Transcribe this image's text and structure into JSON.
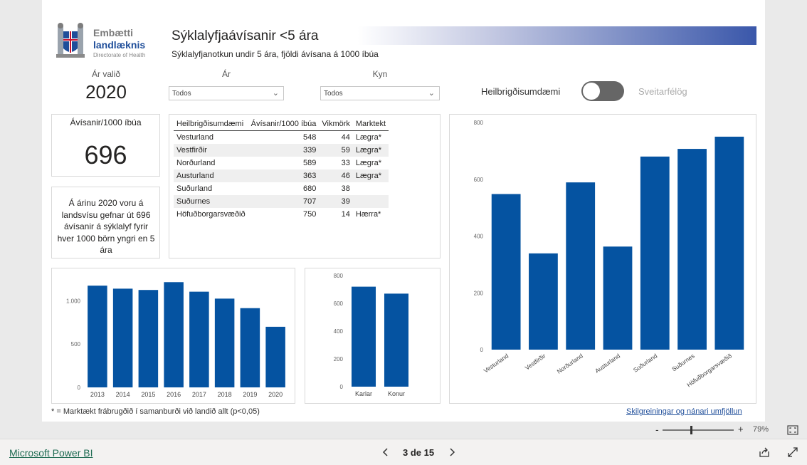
{
  "header": {
    "logo": {
      "line1": "Embætti",
      "line2": "landlæknis",
      "line3": "Directorate of Health"
    },
    "title": "Sýklalyfjaávísanir <5 ára",
    "subtitle": "Sýklalyfjanotkun undir 5 ára, fjöldi ávísana á 1000 íbúa"
  },
  "filters": {
    "year_selected_label": "Ár valið",
    "year_selected": "2020",
    "year_label": "Ár",
    "year_value": "Todos",
    "sex_label": "Kyn",
    "sex_value": "Todos",
    "toggle_left": "Heilbrigðisumdæmi",
    "toggle_right": "Sveitarfélög"
  },
  "kpi": {
    "label": "Ávísanir/1000 íbúa",
    "value": "696"
  },
  "note_text": "Á árinu 2020 voru á landsvísu gefnar út 696 ávísanir á sýklalyf fyrir hver 1000 börn yngri en 5 ára",
  "table": {
    "headers": [
      "Heilbrigðisumdæmi",
      "Ávísanir/1000 íbúa",
      "Vikmörk",
      "Marktekt"
    ],
    "rows": [
      [
        "Vesturland",
        "548",
        "44",
        "Lægra*"
      ],
      [
        "Vestfirðir",
        "339",
        "59",
        "Lægra*"
      ],
      [
        "Norðurland",
        "589",
        "33",
        "Lægra*"
      ],
      [
        "Austurland",
        "363",
        "46",
        "Lægra*"
      ],
      [
        "Suðurland",
        "680",
        "38",
        ""
      ],
      [
        "Suðurnes",
        "707",
        "39",
        ""
      ],
      [
        "Höfuðborgarsvæðið",
        "750",
        "14",
        "Hærra*"
      ]
    ]
  },
  "chart_data": [
    {
      "id": "years",
      "type": "bar",
      "categories": [
        "2013",
        "2014",
        "2015",
        "2016",
        "2017",
        "2018",
        "2019",
        "2020"
      ],
      "values": [
        1175,
        1140,
        1125,
        1215,
        1105,
        1025,
        915,
        700
      ],
      "yticks": [
        0,
        500,
        1000
      ],
      "ytick_labels": [
        "0",
        "500",
        "1.000"
      ],
      "ylim": [
        0,
        1250
      ],
      "color": "#0553a1"
    },
    {
      "id": "sex",
      "type": "bar",
      "categories": [
        "Karlar",
        "Konur"
      ],
      "values": [
        720,
        670
      ],
      "yticks": [
        0,
        200,
        400,
        600,
        800
      ],
      "ytick_labels": [
        "0",
        "200",
        "400",
        "600",
        "800"
      ],
      "ylim": [
        0,
        800
      ],
      "color": "#0553a1"
    },
    {
      "id": "regions",
      "type": "bar",
      "categories": [
        "Vesturland",
        "Vestfirðir",
        "Norðurland",
        "Austurland",
        "Suðurland",
        "Suðurnes",
        "Höfuðborgarsvæðið"
      ],
      "values": [
        548,
        339,
        589,
        363,
        680,
        707,
        750
      ],
      "yticks": [
        0,
        200,
        400,
        600,
        800
      ],
      "ytick_labels": [
        "0",
        "200",
        "400",
        "600",
        "800"
      ],
      "ylim": [
        0,
        800
      ],
      "color": "#0553a1"
    }
  ],
  "footnote": "* = Marktækt frábrugðið í samanburði við landið allt (p<0,05)",
  "link_text": "Skilgreiningar og nánari umfjöllun",
  "zoom": {
    "minus": "-",
    "plus": "+",
    "level": "79%",
    "value": 0.79
  },
  "footer": {
    "brand": "Microsoft Power BI",
    "page_indicator": "3 de 15"
  },
  "colors": {
    "bar": "#0553a1",
    "title_gradient_end": "#3a57aa"
  }
}
